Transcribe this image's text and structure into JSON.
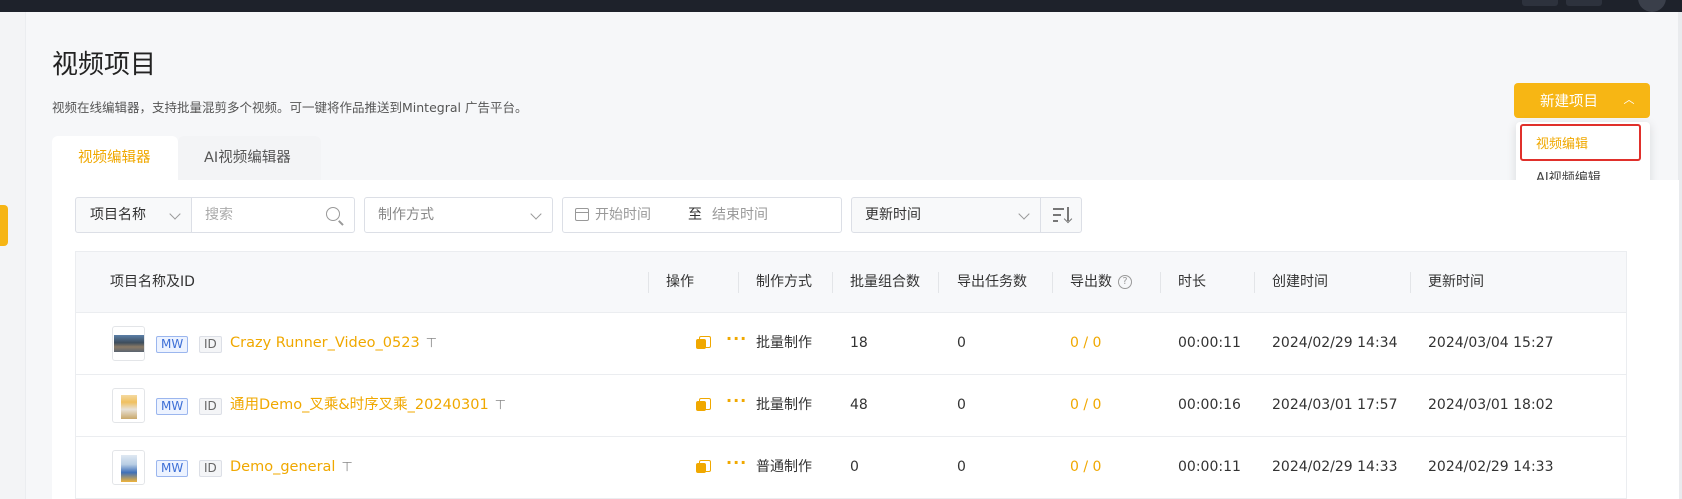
{
  "page": {
    "title": "视频项目",
    "description": "视频在线编辑器，支持批量混剪多个视频。可一键将作品推送到Mintegral 广告平台。"
  },
  "new_button": {
    "label": "新建项目",
    "dropdown": [
      "视频编辑",
      "AI视频编辑"
    ]
  },
  "tabs": [
    {
      "label": "视频编辑器",
      "active": true
    },
    {
      "label": "AI视频编辑器",
      "active": false
    }
  ],
  "filters": {
    "project_select": "项目名称",
    "search_placeholder": "搜索",
    "method_placeholder": "制作方式",
    "date_start": "开始时间",
    "date_sep": "至",
    "date_end": "结束时间",
    "sort_by": "更新时间"
  },
  "table": {
    "headers": [
      "项目名称及ID",
      "操作",
      "制作方式",
      "批量组合数",
      "导出任务数",
      "导出数",
      "时长",
      "创建时间",
      "更新时间"
    ],
    "rows": [
      {
        "tag_mw": "MW",
        "tag_id": "ID",
        "name": "Crazy Runner_Video_0523",
        "method": "批量制作",
        "combos": "18",
        "tasks": "0",
        "exports": "0 / 0",
        "duration": "00:00:11",
        "created": "2024/02/29 14:34",
        "updated": "2024/03/04 15:27"
      },
      {
        "tag_mw": "MW",
        "tag_id": "ID",
        "name": "通用Demo_叉乘&时序叉乘_20240301",
        "method": "批量制作",
        "combos": "48",
        "tasks": "0",
        "exports": "0 / 0",
        "duration": "00:00:16",
        "created": "2024/03/01 17:57",
        "updated": "2024/03/01 18:02"
      },
      {
        "tag_mw": "MW",
        "tag_id": "ID",
        "name": "Demo_general",
        "method": "普通制作",
        "combos": "0",
        "tasks": "0",
        "exports": "0 / 0",
        "duration": "00:00:11",
        "created": "2024/02/29 14:33",
        "updated": "2024/02/29 14:33"
      }
    ]
  },
  "colors": {
    "accent": "#f7b614",
    "link": "#f0a800",
    "highlight_box": "#e0302b"
  }
}
